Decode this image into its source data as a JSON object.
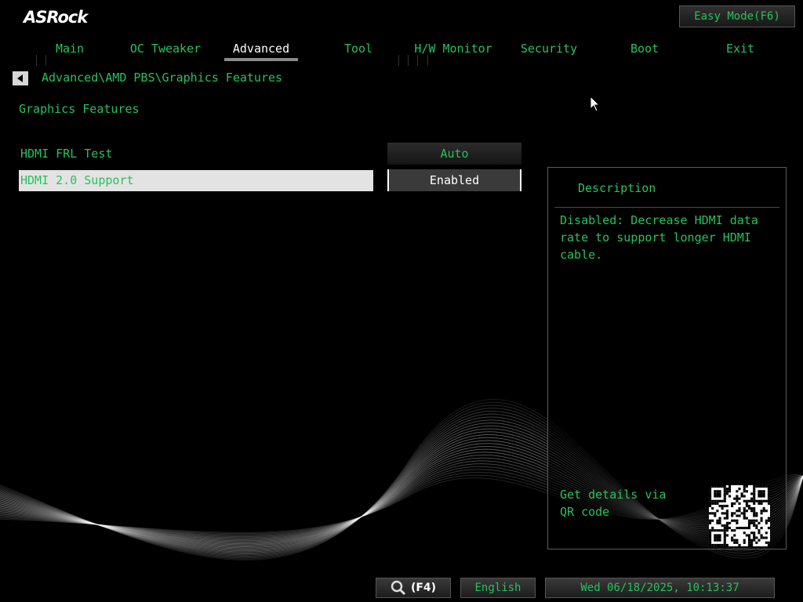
{
  "brand": {
    "logo_text": "ASRock"
  },
  "header": {
    "easy_mode_label": "Easy Mode(F6)"
  },
  "tabs": [
    {
      "label": "Main"
    },
    {
      "label": "OC Tweaker"
    },
    {
      "label": "Advanced",
      "active": true
    },
    {
      "label": "Tool"
    },
    {
      "label": "H/W Monitor"
    },
    {
      "label": "Security"
    },
    {
      "label": "Boot"
    },
    {
      "label": "Exit"
    }
  ],
  "breadcrumb": {
    "path": "Advanced\\AMD PBS\\Graphics Features",
    "back_icon": "left-arrow-icon"
  },
  "page": {
    "title": "Graphics Features",
    "settings": [
      {
        "label": "HDMI FRL Test",
        "value": "Auto",
        "selected": false
      },
      {
        "label": "HDMI 2.0 Support",
        "value": "Enabled",
        "selected": true
      }
    ]
  },
  "description": {
    "title": "Description",
    "text": "Disabled: Decrease HDMI data rate to support longer HDMI cable.",
    "qr_prompt": "Get details via QR code"
  },
  "footer": {
    "search_label": "(F4)",
    "search_icon": "search-icon",
    "language": "English",
    "datetime": "Wed 06/18/2025, 10:13:37"
  },
  "colors": {
    "text_green": "#27c25a",
    "background": "#000000",
    "highlight": "#e3e3e3"
  }
}
